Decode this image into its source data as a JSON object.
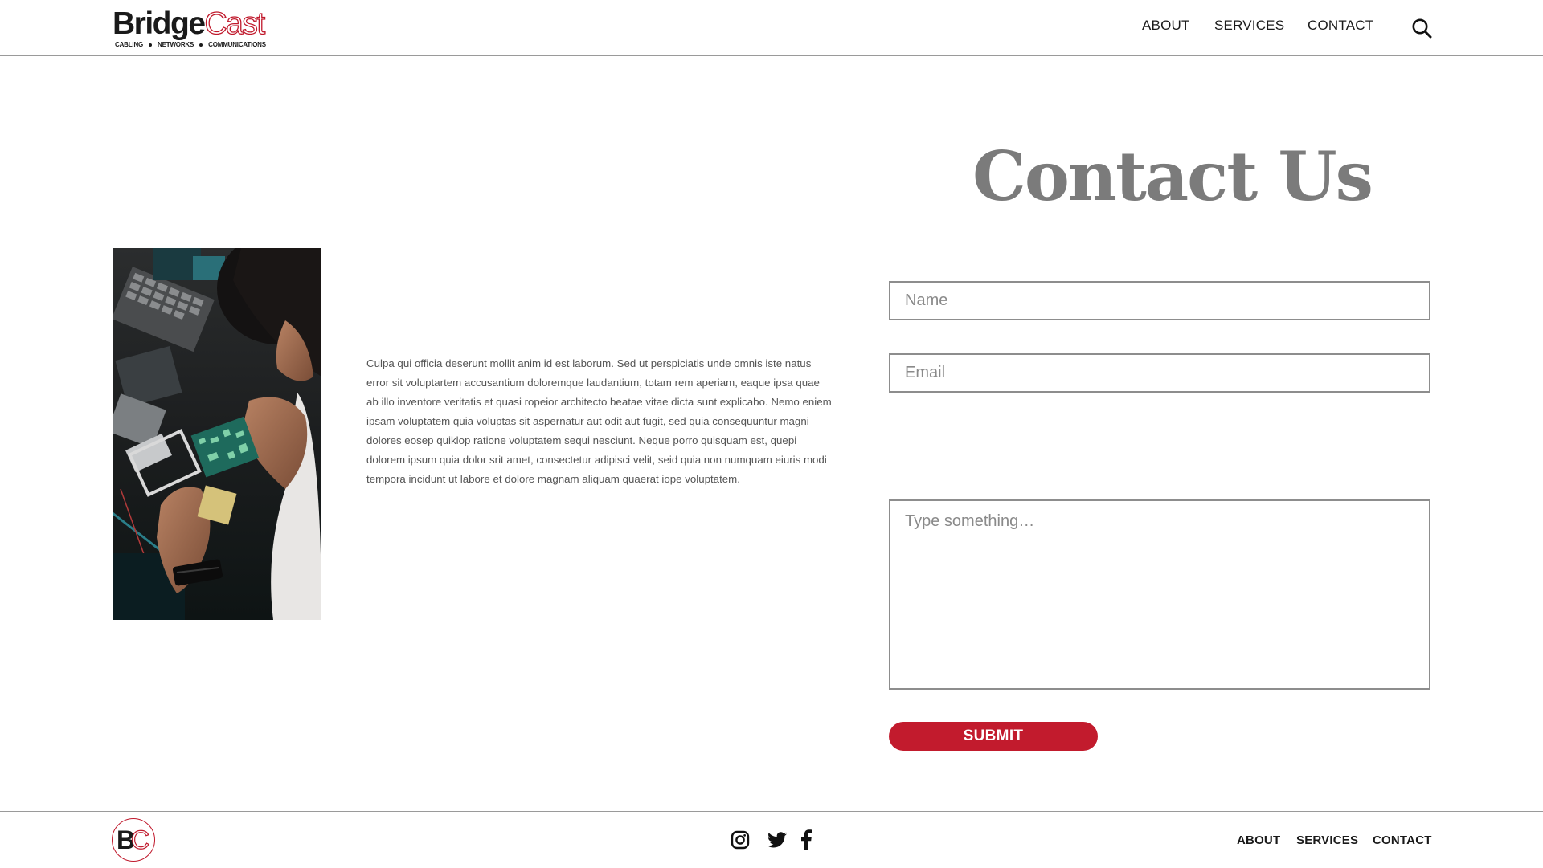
{
  "brand": {
    "name_bold": "Bridge",
    "name_outline": "Cast",
    "tagline": [
      "CABLING",
      "NETWORKS",
      "COMMUNICATIONS"
    ],
    "footer_mark": {
      "b": "B",
      "c": "C"
    },
    "accent_color": "#c21b2d"
  },
  "header": {
    "nav": [
      {
        "label": "ABOUT"
      },
      {
        "label": "SERVICES"
      },
      {
        "label": "CONTACT"
      }
    ],
    "search_icon": "search-icon"
  },
  "main": {
    "title": "Contact Us",
    "photo_alt": "technician-repairing-circuit-board",
    "body": "Culpa qui officia deserunt mollit anim id est laborum. Sed ut perspiciatis unde omnis iste natus error sit voluptartem accusantium doloremque laudantium, totam rem aperiam, eaque ipsa quae ab illo inventore veritatis et quasi ropeior architecto beatae vitae dicta sunt explicabo. Nemo eniem ipsam voluptatem quia voluptas sit aspernatur aut odit aut fugit, sed quia consequuntur magni dolores eosep quiklop ratione voluptatem sequi nesciunt. Neque porro quisquam est, quepi dolorem ipsum quia dolor srit amet, consectetur adipisci velit, seid quia non numquam eiuris modi tempora incidunt ut labore et dolore magnam aliquam quaerat iope voluptatem."
  },
  "form": {
    "name": {
      "value": "",
      "placeholder": "Name"
    },
    "email": {
      "value": "",
      "placeholder": "Email"
    },
    "message": {
      "value": "",
      "placeholder": "Type something…"
    },
    "submit_label": "SUBMIT"
  },
  "footer": {
    "social": [
      "instagram-icon",
      "twitter-icon",
      "facebook-icon"
    ],
    "nav": [
      {
        "label": "ABOUT"
      },
      {
        "label": "SERVICES"
      },
      {
        "label": "CONTACT"
      }
    ]
  }
}
